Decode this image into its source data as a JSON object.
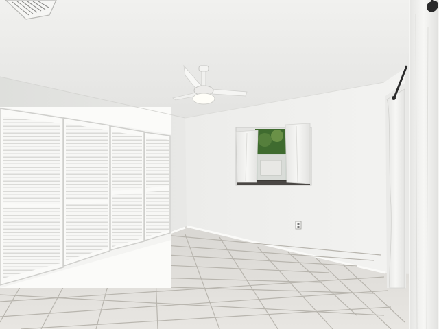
{
  "scene": {
    "subject": "empty-bedroom",
    "colors": {
      "ceiling": "#ecebea",
      "left_wall": "#e6e6e4",
      "back_wall": "#efefed",
      "floor": "#e2e0dc",
      "grout": "#b9b6b0",
      "closet_door": "#f6f6f4",
      "curtain": "#f4f4f2",
      "fan": "#f3f3f1",
      "foliage": "#3f6b2f",
      "rod": "#2a2a2a"
    },
    "closet_door_count": 4,
    "window_panes": 1
  }
}
